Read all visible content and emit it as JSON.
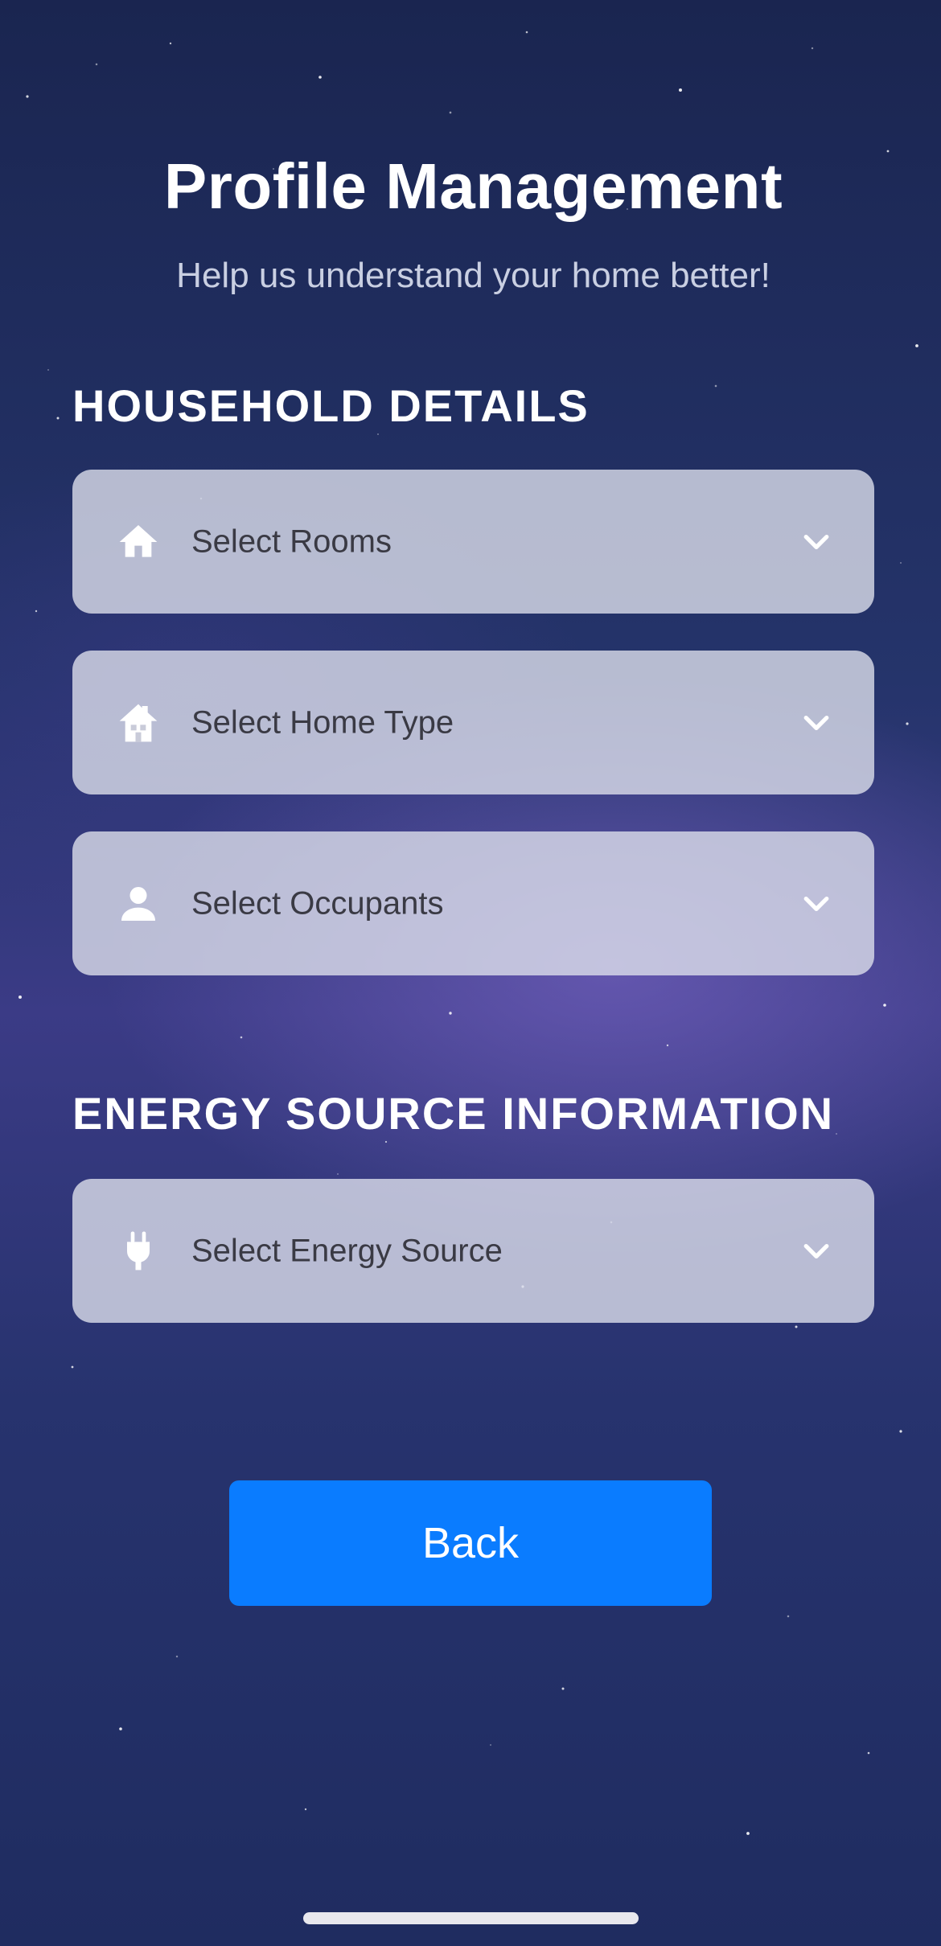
{
  "header": {
    "title": "Profile Management",
    "subtitle": "Help us understand your home better!"
  },
  "household": {
    "heading": "HOUSEHOLD DETAILS",
    "dropdowns": [
      {
        "label": "Select Rooms",
        "icon": "home-icon"
      },
      {
        "label": "Select Home Type",
        "icon": "house-building-icon"
      },
      {
        "label": "Select Occupants",
        "icon": "person-icon"
      }
    ]
  },
  "energy": {
    "heading": "ENERGY SOURCE INFORMATION",
    "dropdowns": [
      {
        "label": "Select Energy Source",
        "icon": "plug-icon"
      }
    ]
  },
  "actions": {
    "back_label": "Back"
  },
  "colors": {
    "accent": "#0a7cff",
    "field_bg": "#dcdeeb",
    "background": "#1f2752"
  }
}
